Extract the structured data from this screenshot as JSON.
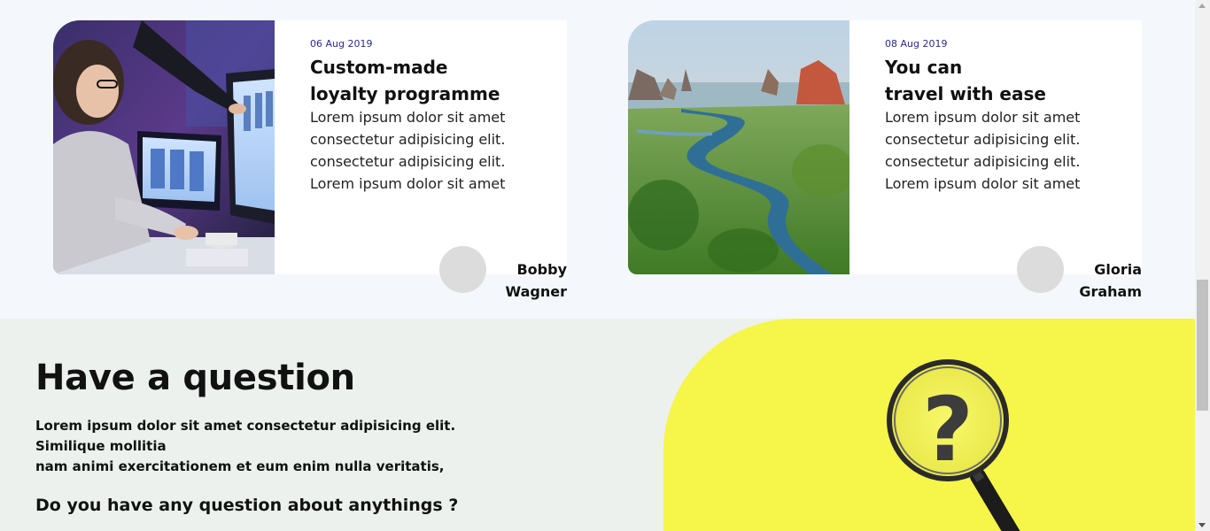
{
  "blog": {
    "cards": [
      {
        "date": "06 Aug 2019",
        "title_lines": [
          "Custom-made",
          "loyalty programme"
        ],
        "text_lines": [
          "Lorem ipsum dolor sit amet",
          "consectetur adipisicing elit.",
          "consectetur adipisicing elit.",
          "Lorem ipsum dolor sit amet"
        ],
        "author_lines": [
          "Bobby",
          "Wagner"
        ],
        "image": "designer-at-computer-photo"
      },
      {
        "date": "08 Aug 2019",
        "title_lines": [
          "You can",
          "travel with ease"
        ],
        "text_lines": [
          "Lorem ipsum dolor sit amet",
          "consectetur adipisicing elit.",
          "consectetur adipisicing elit.",
          "Lorem ipsum dolor sit amet"
        ],
        "author_lines": [
          "Gloria",
          "Graham"
        ],
        "image": "river-landscape-photo"
      }
    ]
  },
  "question": {
    "title": "Have a question",
    "text_lines": [
      "Lorem ipsum dolor sit amet consectetur adipisicing elit. Similique mollitia",
      "nam animi exercitationem et eum enim nulla veritatis,"
    ],
    "subtitle": "Do you have any question about anythings ?",
    "image": "magnifier-question-mark-photo"
  },
  "colors": {
    "page_bg": "#f4f8fc",
    "card_bg": "#ffffff",
    "date": "#2a2a8c",
    "question_bg": "#ecf1ee",
    "yellow": "#f6f54a"
  }
}
